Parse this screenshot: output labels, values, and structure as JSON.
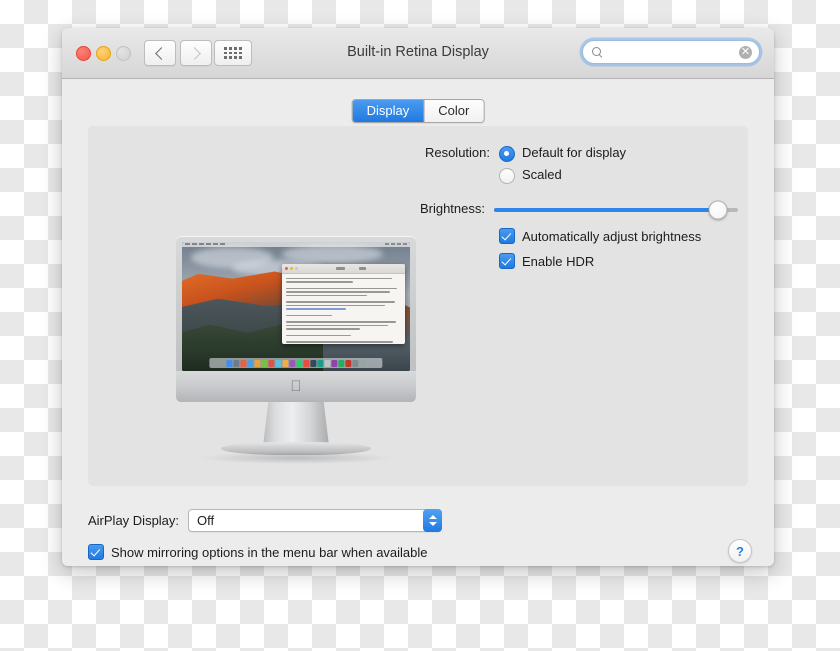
{
  "window": {
    "title": "Built-in Retina Display",
    "traffic_lights": {
      "close": "close-button",
      "minimize": "minimize-button",
      "zoom": "zoom-button"
    },
    "nav": {
      "back": "back-button",
      "forward": "forward-button",
      "grid": "show-all-button"
    }
  },
  "search": {
    "value": "",
    "placeholder": "",
    "clear_glyph": "✕"
  },
  "tabs": [
    {
      "label": "Display",
      "active": true
    },
    {
      "label": "Color",
      "active": false
    }
  ],
  "resolution": {
    "label": "Resolution:",
    "options": [
      {
        "label": "Default for display",
        "selected": true
      },
      {
        "label": "Scaled",
        "selected": false
      }
    ]
  },
  "brightness": {
    "label": "Brightness:",
    "value_percent": 92
  },
  "checkboxes": [
    {
      "label": "Automatically adjust brightness",
      "checked": true
    },
    {
      "label": "Enable HDR",
      "checked": true
    }
  ],
  "airplay": {
    "label": "AirPlay Display:",
    "value": "Off",
    "options": [
      "Off"
    ]
  },
  "mirroring": {
    "label": "Show mirroring options in the menu bar when available",
    "checked": true
  },
  "help": {
    "glyph": "?"
  },
  "display_preview": {
    "device": "iMac",
    "wallpaper": "El Capitan",
    "apple_logo": "",
    "document_window": "TextEdit document",
    "dock_icon_colors": [
      "#3d8ef0",
      "#6f7b88",
      "#e85f4a",
      "#4f9de0",
      "#e8a33d",
      "#7bc043",
      "#d9534f",
      "#5bc0de",
      "#f0ad4e",
      "#9b59b6",
      "#2ecc71",
      "#e74c3c",
      "#34495e",
      "#16a085",
      "#bdc3c7",
      "#8e44ad",
      "#27ae60",
      "#c0392b",
      "#7f8c8d",
      "#95a5a6"
    ]
  },
  "colors": {
    "accent_blue": "#1f7ae0",
    "window_bg": "#ececec",
    "panel_bg": "#e3e3e3",
    "titlebar_top": "#e9e9e9",
    "titlebar_bottom": "#d6d6d6"
  }
}
